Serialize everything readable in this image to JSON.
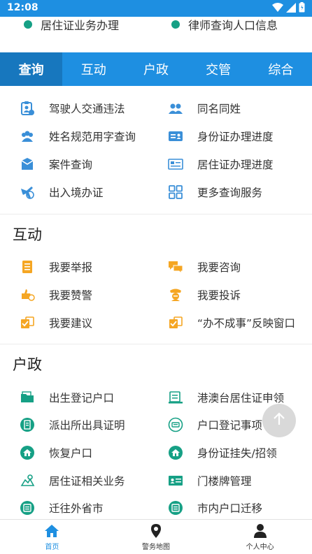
{
  "status": {
    "time": "12:08"
  },
  "prev_row": [
    {
      "label": "居住证业务办理"
    },
    {
      "label": "律师查询人口信息"
    }
  ],
  "tabs": [
    {
      "label": "查询",
      "active": true
    },
    {
      "label": "互动"
    },
    {
      "label": "户政"
    },
    {
      "label": "交管"
    },
    {
      "label": "综合"
    }
  ],
  "query": {
    "items": [
      {
        "label": "驾驶人交通违法",
        "icon": "driver-license-icon"
      },
      {
        "label": "同名同姓",
        "icon": "people-icon"
      },
      {
        "label": "姓名规范用字查询",
        "icon": "group-icon"
      },
      {
        "label": "身份证办理进度",
        "icon": "id-card-icon"
      },
      {
        "label": "案件查询",
        "icon": "case-box-icon"
      },
      {
        "label": "居住证办理进度",
        "icon": "residence-card-icon"
      },
      {
        "label": "出入境办证",
        "icon": "airplane-globe-icon"
      },
      {
        "label": "更多查询服务",
        "icon": "grid-more-icon"
      }
    ]
  },
  "interact": {
    "title": "互动",
    "items": [
      {
        "label": "我要举报",
        "icon": "report-doc-icon"
      },
      {
        "label": "我要咨询",
        "icon": "chat-bubbles-icon"
      },
      {
        "label": "我要赞警",
        "icon": "thumbs-up-icon"
      },
      {
        "label": "我要投诉",
        "icon": "police-complaint-icon"
      },
      {
        "label": "我要建议",
        "icon": "suggestion-icon"
      },
      {
        "label": "“办不成事”反映窗口",
        "icon": "feedback-window-icon"
      }
    ]
  },
  "household": {
    "title": "户政",
    "items": [
      {
        "label": "出生登记户口",
        "icon": "birth-register-icon"
      },
      {
        "label": "港澳台居住证申领",
        "icon": "hk-macau-card-icon"
      },
      {
        "label": "派出所出具证明",
        "icon": "certificate-icon"
      },
      {
        "label": "户口登记事项",
        "icon": "household-register-icon"
      },
      {
        "label": "恢复户口",
        "icon": "restore-household-icon"
      },
      {
        "label": "身份证挂失/招领",
        "icon": "id-lost-found-icon"
      },
      {
        "label": "居住证相关业务",
        "icon": "residence-business-icon"
      },
      {
        "label": "门楼牌管理",
        "icon": "house-plate-icon"
      },
      {
        "label": "迁往外省市",
        "icon": "move-out-icon"
      },
      {
        "label": "市内户口迁移",
        "icon": "city-transfer-icon"
      }
    ]
  },
  "bottom_nav": [
    {
      "label": "首页",
      "icon": "home-icon",
      "active": true
    },
    {
      "label": "警务地图",
      "icon": "map-pin-icon"
    },
    {
      "label": "个人中心",
      "icon": "person-icon"
    }
  ],
  "colors": {
    "primary": "#1e8fe1",
    "tab_active": "#1777be",
    "blue_icon": "#3a8fd8",
    "orange_icon": "#f5a623",
    "green_icon": "#16a085"
  }
}
